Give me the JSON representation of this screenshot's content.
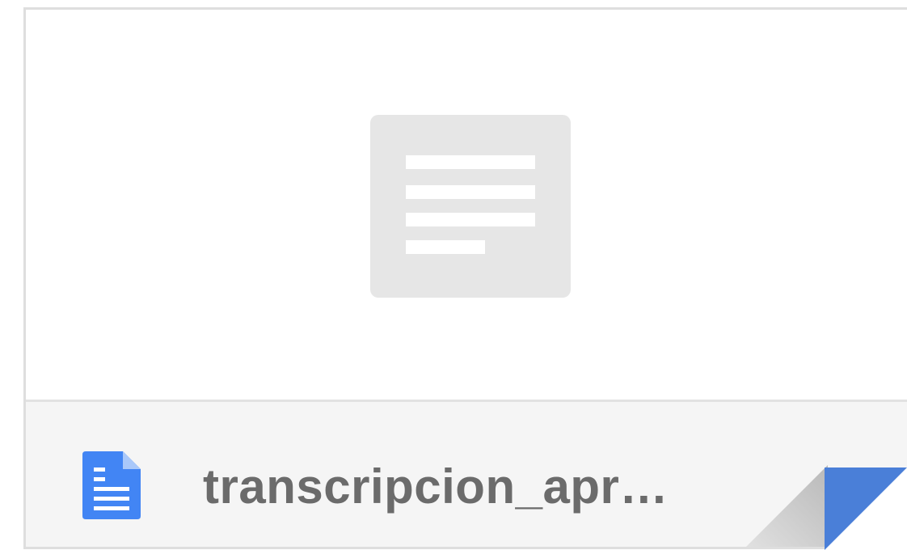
{
  "file_card": {
    "file_name": "transcripcion_apr…",
    "file_type_icon": "google-docs-icon",
    "preview_icon": "document-lines-icon"
  },
  "colors": {
    "docs_blue": "#4285f4",
    "placeholder_gray": "#e6e6e6",
    "footer_bg": "#f5f5f5",
    "filename_text": "#6b6b6b"
  }
}
